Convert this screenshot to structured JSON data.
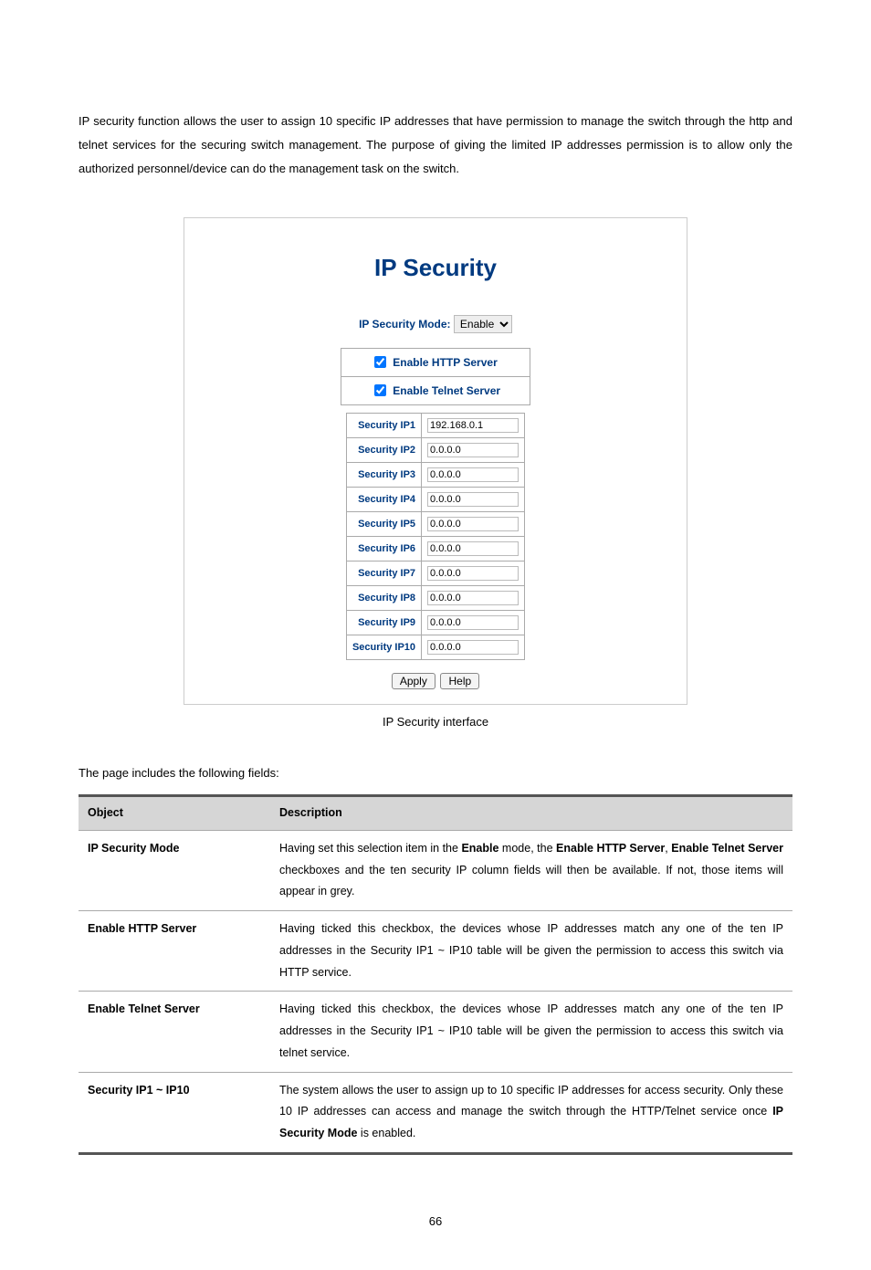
{
  "intro": "IP security function allows the user to assign 10 specific IP addresses that have permission to manage the switch through the http and telnet services for the securing switch management. The purpose of giving the limited IP addresses permission is to allow only the authorized personnel/device can do the management task on the switch.",
  "panel": {
    "title": "IP Security",
    "mode_label": "IP Security Mode:",
    "mode_value": "Enable",
    "enable_http": "Enable HTTP Server",
    "enable_telnet": "Enable Telnet Server",
    "rows": [
      {
        "label": "Security IP1",
        "value": "192.168.0.1"
      },
      {
        "label": "Security IP2",
        "value": "0.0.0.0"
      },
      {
        "label": "Security IP3",
        "value": "0.0.0.0"
      },
      {
        "label": "Security IP4",
        "value": "0.0.0.0"
      },
      {
        "label": "Security IP5",
        "value": "0.0.0.0"
      },
      {
        "label": "Security IP6",
        "value": "0.0.0.0"
      },
      {
        "label": "Security IP7",
        "value": "0.0.0.0"
      },
      {
        "label": "Security IP8",
        "value": "0.0.0.0"
      },
      {
        "label": "Security IP9",
        "value": "0.0.0.0"
      },
      {
        "label": "Security IP10",
        "value": "0.0.0.0"
      }
    ],
    "apply": "Apply",
    "help": "Help"
  },
  "caption": "IP Security interface",
  "fields_intro": "The page includes the following fields:",
  "th_object": "Object",
  "th_description": "Description",
  "desc": [
    {
      "obj": "IP Security Mode",
      "text_parts": [
        "Having set this selection item in the ",
        "Enable",
        " mode, the ",
        "Enable HTTP Server",
        ", ",
        "Enable Telnet Server",
        " checkboxes and the ten security IP column fields will then be available. If not, those items will appear in grey."
      ]
    },
    {
      "obj": "Enable HTTP Server",
      "text": "Having ticked this checkbox, the devices whose IP addresses match any one of the ten IP addresses in the Security IP1 ~ IP10 table will be given the permission to access this switch via HTTP service."
    },
    {
      "obj": "Enable Telnet Server",
      "text": "Having ticked this checkbox, the devices whose IP addresses match any one of the ten IP addresses in the Security IP1 ~ IP10 table will be given the permission to access this switch via telnet service."
    },
    {
      "obj": "Security IP1 ~ IP10",
      "text_parts": [
        "The system allows the user to assign up to 10 specific IP addresses for access security. Only these 10 IP addresses can access and manage the switch through the HTTP/Telnet service once ",
        "IP Security Mode",
        " is enabled."
      ]
    }
  ],
  "page_number": "66"
}
